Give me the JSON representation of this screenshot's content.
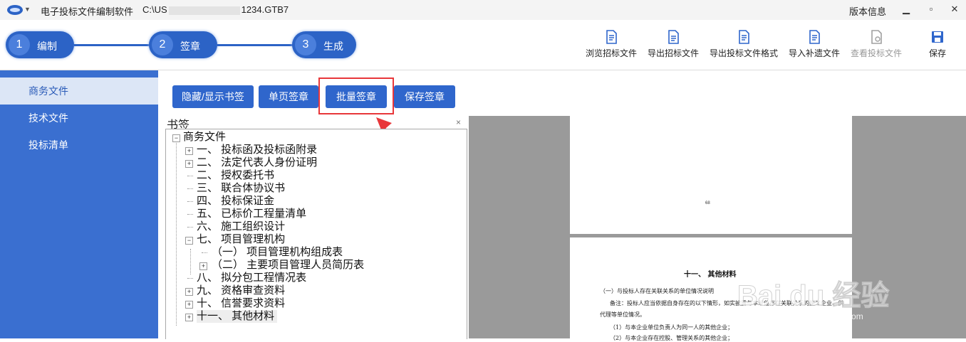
{
  "titlebar": {
    "app_name": "电子投标文件编制软件",
    "path_prefix": "C:\\US",
    "path_suffix": "1234.GTB7",
    "version_label": "版本信息"
  },
  "steps": [
    {
      "num": "1",
      "label": "编制"
    },
    {
      "num": "2",
      "label": "签章"
    },
    {
      "num": "3",
      "label": "生成"
    }
  ],
  "tools": [
    {
      "label": "浏览招标文件",
      "icon": "document-view-icon",
      "enabled": true
    },
    {
      "label": "导出招标文件",
      "icon": "document-export-icon",
      "enabled": true
    },
    {
      "label": "导出投标文件格式",
      "icon": "document-export-format-icon",
      "enabled": true
    },
    {
      "label": "导入补遗文件",
      "icon": "document-import-icon",
      "enabled": true
    },
    {
      "label": "查看投标文件",
      "icon": "document-search-icon",
      "enabled": false
    },
    {
      "label": "保存",
      "icon": "save-icon",
      "enabled": true
    }
  ],
  "sidebar": {
    "items": [
      {
        "label": "商务文件",
        "active": true
      },
      {
        "label": "技术文件",
        "active": false
      },
      {
        "label": "投标清单",
        "active": false
      }
    ]
  },
  "actions": {
    "toggle_bookmark": "隐藏/显示书签",
    "single_sign": "单页签章",
    "batch_sign": "批量签章",
    "save_sign": "保存签章"
  },
  "bookmark": {
    "title": "书签",
    "close": "×",
    "root": "商务文件",
    "items": [
      "一、 投标函及投标函附录",
      "二、 法定代表人身份证明",
      "二、 授权委托书",
      "三、 联合体协议书",
      "四、 投标保证金",
      "五、 已标价工程量清单",
      "六、 施工组织设计",
      "七、 项目管理机构",
      "（一） 项目管理机构组成表",
      "（二） 主要项目管理人员简历表",
      "八、 拟分包工程情况表",
      "九、 资格审查资料",
      "十、 信誉要求资料",
      "十一、 其他材料"
    ]
  },
  "preview": {
    "page_number": "68",
    "heading": "十一、    其他材料",
    "lines": [
      "（一）与投标人存在关联关系的单位情况说明",
      "备注：投标人应当依据自身存在的以下情形，如实披露与本单位存在关联关系的施工企业、供",
      "代理等单位情况。",
      "（1）与本企业单位负责人为同一人的其他企业；",
      "（2）与本企业存在控股、管理关系的其他企业；"
    ]
  },
  "watermark": {
    "text": "Bai du 经验",
    "sub": "jingyan.baidu.com"
  },
  "colors": {
    "primary": "#2f66cc",
    "sidebar": "#3a6fd0",
    "highlight": "#e8373a"
  }
}
